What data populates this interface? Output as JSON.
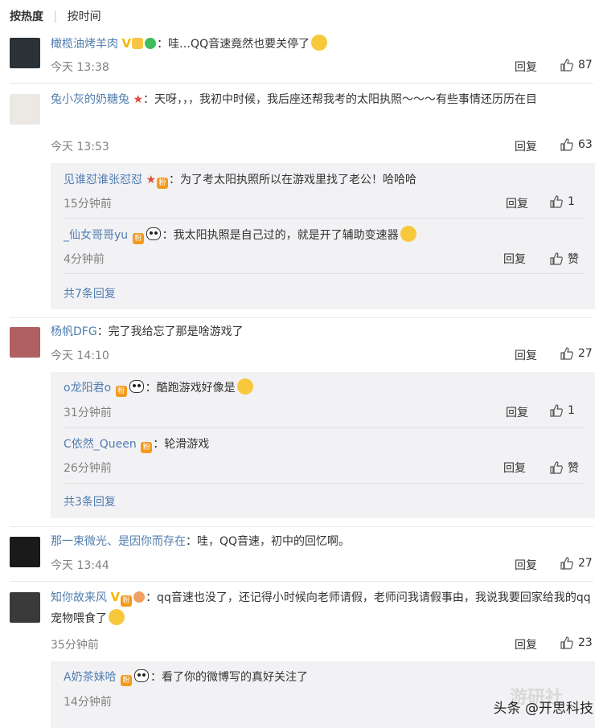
{
  "sort": {
    "hot": "按热度",
    "time": "按时间"
  },
  "comments": [
    {
      "user": "橄榄油烤羊肉",
      "text": "：哇…QQ音速竟然也要关停了",
      "time": "今天 13:38",
      "reply": "回复",
      "likes": "87"
    },
    {
      "user": "兔小灰的奶糖兔",
      "text": "：天呀，，，我初中时候，我后座还帮我考的太阳执照～～～有些事情还历历在目",
      "time": "今天 13:53",
      "reply": "回复",
      "likes": "63",
      "subs": [
        {
          "user": "见谁怼谁张怼怼",
          "text": "：为了考太阳执照所以在游戏里找了老公！哈哈哈",
          "time": "15分钟前",
          "reply": "回复",
          "likes": "1"
        },
        {
          "user": "_仙女哥哥yu",
          "text": "：我太阳执照是自己过的，就是开了辅助变速器",
          "time": "4分钟前",
          "reply": "回复",
          "likes": "赞"
        }
      ],
      "more": "共7条回复"
    },
    {
      "user": "杨帆DFG",
      "text": "：完了我给忘了那是啥游戏了",
      "time": "今天 14:10",
      "reply": "回复",
      "likes": "27",
      "subs": [
        {
          "user": "o龙阳君o",
          "text": "：酷跑游戏好像是",
          "time": "31分钟前",
          "reply": "回复",
          "likes": "1"
        },
        {
          "user": "C依然_Queen",
          "text": "：轮滑游戏",
          "time": "26分钟前",
          "reply": "回复",
          "likes": "赞"
        }
      ],
      "more": "共3条回复"
    },
    {
      "user": "那一束微光、是因你而存在",
      "text": "：哇，QQ音速，初中的回忆啊。",
      "time": "今天 13:44",
      "reply": "回复",
      "likes": "27"
    },
    {
      "user": "知你故来风",
      "text": "：qq音速也没了，还记得小时候向老师请假，老师问我请假事由，我说我要回家给我的qq宠物喂食了",
      "time": "35分钟前",
      "reply": "回复",
      "likes": "23",
      "subs": [
        {
          "user": "A奶茶妹哈",
          "text": "：看了你的微博写的真好关注了",
          "time": "14分钟前"
        }
      ]
    }
  ],
  "watermark": "头条 @开思科技",
  "watermark2": "游研社",
  "colors": {
    "link": "#507daf",
    "meta": "#808080",
    "subbg": "#f2f2f5"
  },
  "icons": [
    "thumbs-up-icon",
    "emoji-icon",
    "vip-badge-icon",
    "fan-badge-icon",
    "panda-icon"
  ]
}
